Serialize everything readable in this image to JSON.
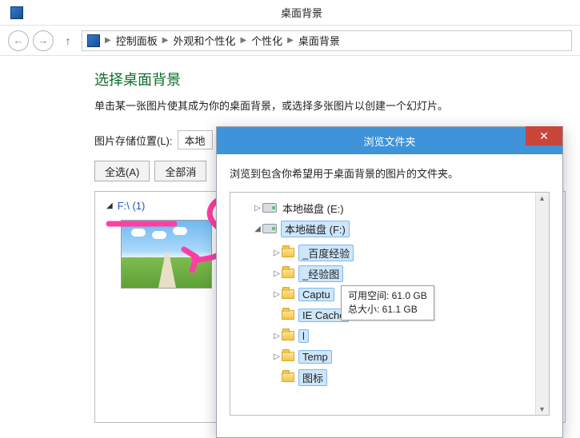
{
  "window": {
    "title": "桌面背景"
  },
  "nav": {
    "crumbs": [
      "控制面板",
      "外观和个性化",
      "个性化",
      "桌面背景"
    ]
  },
  "page": {
    "title": "选择桌面背景",
    "desc": "单击某一张图片使其成为你的桌面背景，或选择多张图片以创建一个幻灯片。",
    "location_label": "图片存储位置(L):",
    "location_value": "本地",
    "select_all": "全选(A)",
    "select_none": "全部消",
    "group_label": "F:\\ (1)"
  },
  "dialog": {
    "title": "浏览文件夹",
    "instruction": "浏览到包含你希望用于桌面背景的图片的文件夹。",
    "close": "✕",
    "tree": {
      "drive_e": "本地磁盘 (E:)",
      "drive_f": "本地磁盘 (F:)",
      "children": [
        "_百度经验",
        "_经验图",
        "Captu",
        "IE Cache",
        "l",
        "Temp",
        "图标"
      ]
    },
    "tooltip": {
      "line1": "可用空间: 61.0 GB",
      "line2": "总大小: 61.1 GB"
    }
  }
}
